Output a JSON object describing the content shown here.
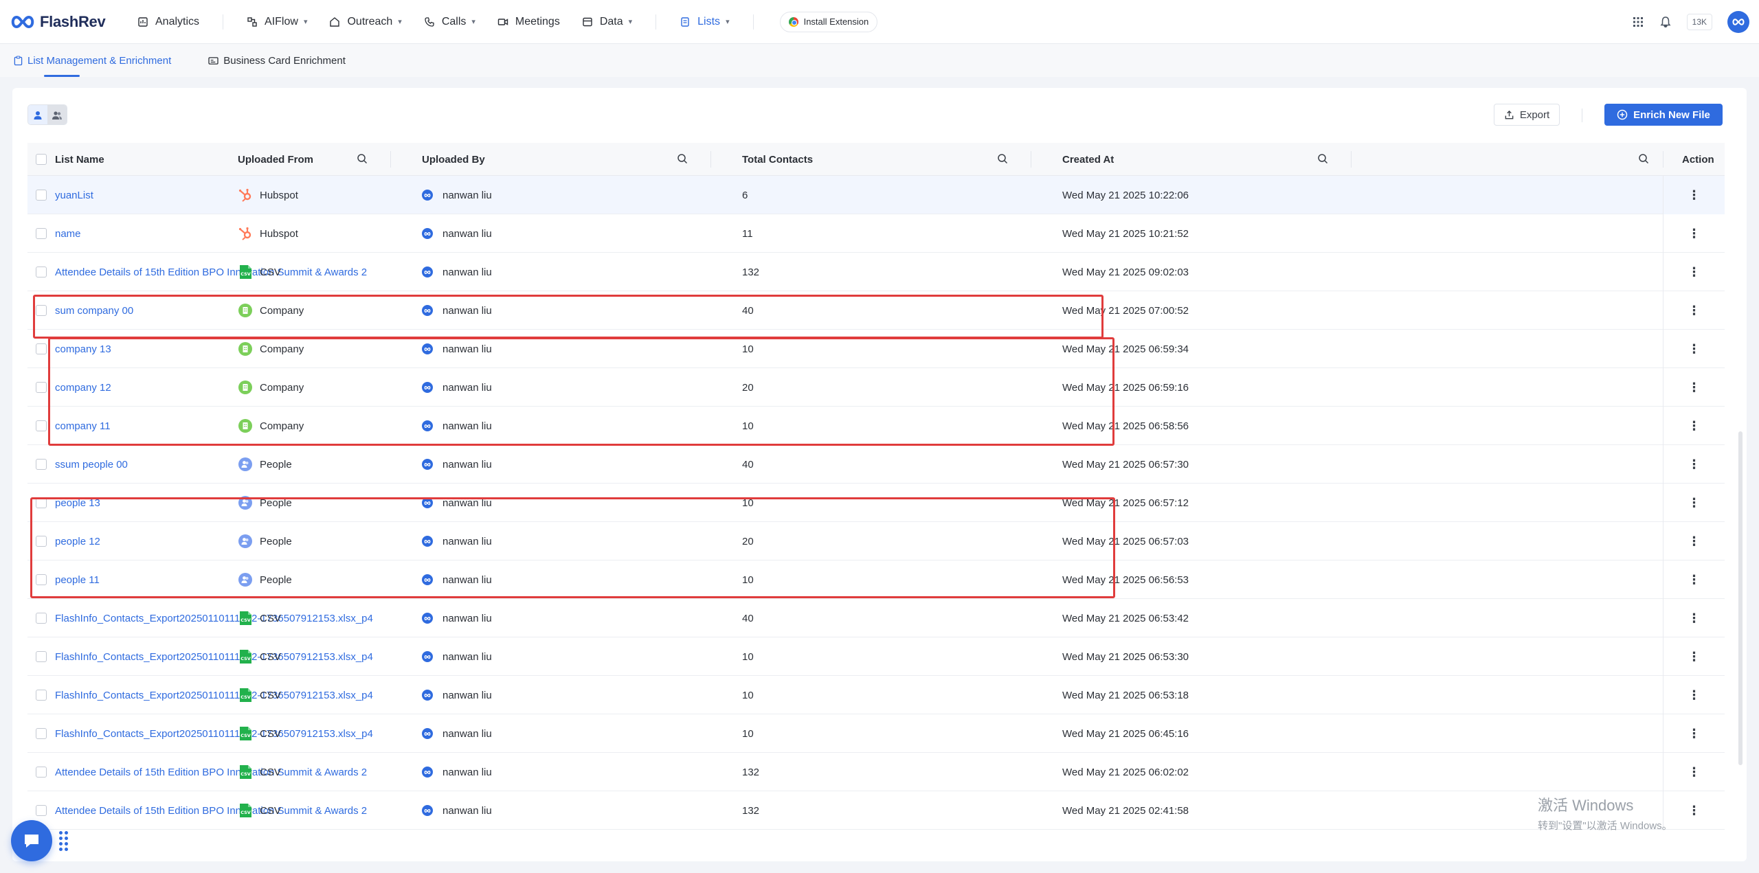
{
  "app": {
    "name": "FlashRev"
  },
  "nav": {
    "items": [
      {
        "label": "Analytics",
        "dropdown": false
      },
      {
        "label": "AIFlow",
        "dropdown": true
      },
      {
        "label": "Outreach",
        "dropdown": true
      },
      {
        "label": "Calls",
        "dropdown": true
      },
      {
        "label": "Meetings",
        "dropdown": false
      },
      {
        "label": "Data",
        "dropdown": true
      },
      {
        "label": "Lists",
        "dropdown": true,
        "active": true
      }
    ],
    "install_extension": "Install Extension",
    "credits": "13K"
  },
  "subtabs": [
    {
      "label": "List Management & Enrichment",
      "active": true
    },
    {
      "label": "Business Card Enrichment",
      "active": false
    }
  ],
  "toolbar": {
    "export_label": "Export",
    "enrich_label": "Enrich New File"
  },
  "table": {
    "columns": [
      "List Name",
      "Uploaded From",
      "Uploaded By",
      "Total Contacts",
      "Created At",
      "Action"
    ],
    "rows": [
      {
        "name": "yuanList",
        "source": "Hubspot",
        "by": "nanwan liu",
        "total": "6",
        "created": "Wed May 21 2025 10:22:06"
      },
      {
        "name": "name",
        "source": "Hubspot",
        "by": "nanwan liu",
        "total": "11",
        "created": "Wed May 21 2025 10:21:52"
      },
      {
        "name": "Attendee Details of 15th Edition BPO Innovation Summit & Awards 2",
        "source": "CSV",
        "by": "nanwan liu",
        "total": "132",
        "created": "Wed May 21 2025 09:02:03"
      },
      {
        "name": "sum company 00",
        "source": "Company",
        "by": "nanwan liu",
        "total": "40",
        "created": "Wed May 21 2025 07:00:52"
      },
      {
        "name": "company 13",
        "source": "Company",
        "by": "nanwan liu",
        "total": "10",
        "created": "Wed May 21 2025 06:59:34"
      },
      {
        "name": "company 12",
        "source": "Company",
        "by": "nanwan liu",
        "total": "20",
        "created": "Wed May 21 2025 06:59:16"
      },
      {
        "name": "company 11",
        "source": "Company",
        "by": "nanwan liu",
        "total": "10",
        "created": "Wed May 21 2025 06:58:56"
      },
      {
        "name": "ssum people 00",
        "source": "People",
        "by": "nanwan liu",
        "total": "40",
        "created": "Wed May 21 2025 06:57:30"
      },
      {
        "name": "people 13",
        "source": "People",
        "by": "nanwan liu",
        "total": "10",
        "created": "Wed May 21 2025 06:57:12"
      },
      {
        "name": "people 12",
        "source": "People",
        "by": "nanwan liu",
        "total": "20",
        "created": "Wed May 21 2025 06:57:03"
      },
      {
        "name": "people 11",
        "source": "People",
        "by": "nanwan liu",
        "total": "10",
        "created": "Wed May 21 2025 06:56:53"
      },
      {
        "name": "FlashInfo_Contacts_Export20250110111832-1736507912153.xlsx_p4",
        "source": "CSV",
        "by": "nanwan liu",
        "total": "40",
        "created": "Wed May 21 2025 06:53:42"
      },
      {
        "name": "FlashInfo_Contacts_Export20250110111832-1736507912153.xlsx_p4",
        "source": "CSV",
        "by": "nanwan liu",
        "total": "10",
        "created": "Wed May 21 2025 06:53:30"
      },
      {
        "name": "FlashInfo_Contacts_Export20250110111832-1736507912153.xlsx_p4",
        "source": "CSV",
        "by": "nanwan liu",
        "total": "10",
        "created": "Wed May 21 2025 06:53:18"
      },
      {
        "name": "FlashInfo_Contacts_Export20250110111832-1736507912153.xlsx_p4",
        "source": "CSV",
        "by": "nanwan liu",
        "total": "10",
        "created": "Wed May 21 2025 06:45:16"
      },
      {
        "name": "Attendee Details of 15th Edition BPO Innovation Summit & Awards 2",
        "source": "CSV",
        "by": "nanwan liu",
        "total": "132",
        "created": "Wed May 21 2025 06:02:02"
      },
      {
        "name": "Attendee Details of 15th Edition BPO Innovation Summit & Awards 2",
        "source": "CSV",
        "by": "nanwan liu",
        "total": "132",
        "created": "Wed May 21 2025 02:41:58"
      }
    ]
  },
  "watermark": {
    "line1": "激活 Windows",
    "line2": "转到\"设置\"以激活 Windows。"
  },
  "colors": {
    "primary": "#2f6bdf",
    "hubspot": "#ff7a59",
    "csv": "#22b14c",
    "company": "#7ccf5a",
    "people": "#7b9ef0",
    "annotation": "#e03c3c"
  }
}
